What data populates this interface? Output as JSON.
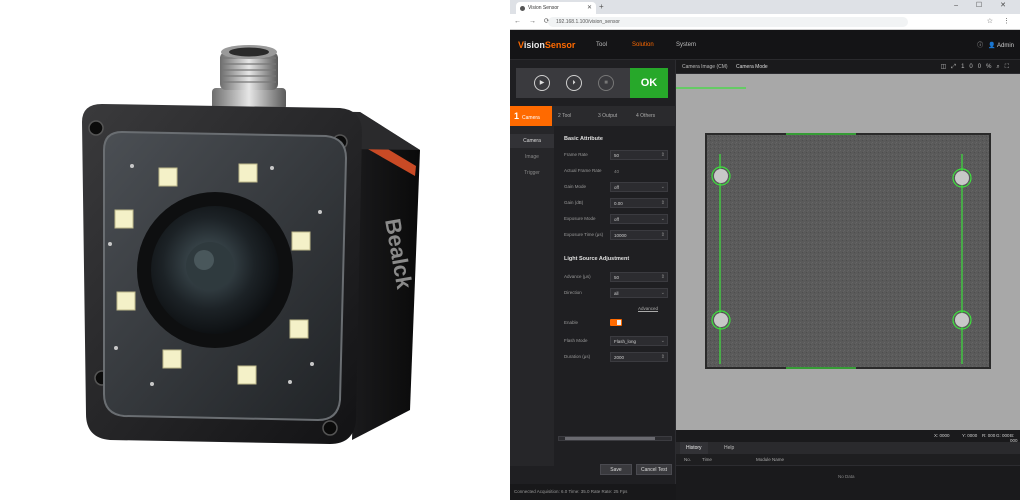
{
  "browser": {
    "tab_title": "Vision Sensor",
    "url": "192.168.1.100/vision_sensor",
    "win_controls": "– ☐ ✕",
    "nav_glyphs": "← → ⟳",
    "ext_glyphs": "☆ ⋮"
  },
  "app": {
    "logo_prefix": "V",
    "logo_main": "ision",
    "logo_suffix": "Sensor",
    "menu": [
      "Tool",
      "Solution",
      "System"
    ],
    "active_menu_index": 1,
    "user": "Admin"
  },
  "run": {
    "ok_label": "OK"
  },
  "steps": [
    {
      "num": "1",
      "label": "Camera"
    },
    {
      "num": "2",
      "label": "Tool"
    },
    {
      "num": "3",
      "label": "Output"
    },
    {
      "num": "4",
      "label": "Others"
    }
  ],
  "subnav": [
    "Camera",
    "Image",
    "Trigger"
  ],
  "basic": {
    "title": "Basic Attribute",
    "rows": [
      {
        "label": "Frame Rate",
        "value": "50",
        "kind": "spin"
      },
      {
        "label": "Actual Frame Rate",
        "value": "40",
        "kind": "ro"
      },
      {
        "label": "Gain Mode",
        "value": "off",
        "kind": "select"
      },
      {
        "label": "Gain (dB)",
        "value": "0.00",
        "kind": "spin"
      },
      {
        "label": "Exposure Mode",
        "value": "off",
        "kind": "select"
      },
      {
        "label": "Exposure Time (μs)",
        "value": "10000",
        "kind": "spin"
      }
    ]
  },
  "light": {
    "title": "Light Source Adjustment",
    "rows": [
      {
        "label": "Advance (μs)",
        "value": "50",
        "kind": "spin"
      },
      {
        "label": "Direction",
        "value": "all",
        "kind": "select"
      }
    ],
    "advanced_link": "Advanced",
    "enable_label": "Enable",
    "rows2": [
      {
        "label": "Flash Mode",
        "value": "Flash_long",
        "kind": "select"
      },
      {
        "label": "Duration (μs)",
        "value": "2000",
        "kind": "spin"
      }
    ]
  },
  "buttons": {
    "save": "Save",
    "cancel": "Cancel Test"
  },
  "status": {
    "text": "Connected   Acquisition: 6.0   Time: 35.0 Rate   Rate: 25 Fps"
  },
  "image_toolbar": {
    "tab1": "Camera Image (CM)",
    "tab2": "Camera Mode",
    "zoom": "100%"
  },
  "coords": {
    "x": "X: 0000",
    "y": "Y: 0000",
    "r": "R: 000",
    "g": "G: 000",
    "b": "B: 000"
  },
  "history": {
    "tabs": [
      "History",
      "Help"
    ],
    "columns": [
      "No.",
      "Time",
      "Module Name"
    ],
    "empty": "No Data"
  },
  "colors": {
    "accent": "#ff6a00",
    "ok": "#27a82a",
    "measure": "#3de03d"
  }
}
